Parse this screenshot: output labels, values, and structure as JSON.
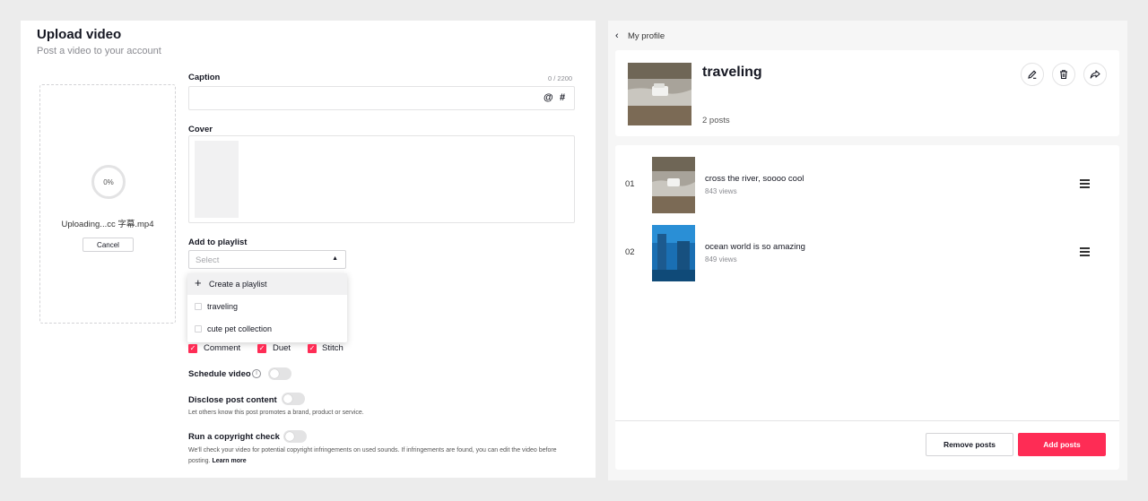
{
  "upload": {
    "title": "Upload video",
    "subtitle": "Post a video to your account",
    "progress": "0%",
    "filename": "Uploading...cc 字幕.mp4",
    "cancel_label": "Cancel"
  },
  "caption": {
    "label": "Caption",
    "counter": "0 / 2200",
    "value": "",
    "mention_icon": "@",
    "hashtag_icon": "#"
  },
  "cover": {
    "label": "Cover"
  },
  "playlist": {
    "label": "Add to playlist",
    "placeholder": "Select",
    "options": [
      {
        "label": "Create a playlist",
        "icon": "plus-icon"
      },
      {
        "label": "traveling",
        "checked": false
      },
      {
        "label": "cute pet collection",
        "checked": false
      }
    ]
  },
  "allow": {
    "items": [
      {
        "label": "Comment",
        "checked": true
      },
      {
        "label": "Duet",
        "checked": true
      },
      {
        "label": "Stitch",
        "checked": true
      }
    ]
  },
  "schedule": {
    "label": "Schedule video",
    "enabled": false
  },
  "disclose": {
    "label": "Disclose post content",
    "enabled": false,
    "note": "Let others know this post promotes a brand, product or service."
  },
  "copyright": {
    "label": "Run a copyright check",
    "enabled": false,
    "note": "We'll check your video for potential copyright infringements on used sounds. If infringements are found, you can edit the video before posting.",
    "learn_more": "Learn more"
  },
  "profile": {
    "back_label": "My profile",
    "playlist_name": "traveling",
    "post_count": "2 posts",
    "actions": [
      "edit-icon",
      "trash-icon",
      "share-icon"
    ],
    "posts": [
      {
        "index": "01",
        "title": "cross the river, soooo cool",
        "views": "843 views"
      },
      {
        "index": "02",
        "title": "ocean world is so amazing",
        "views": "849 views"
      }
    ],
    "remove_label": "Remove posts",
    "add_label": "Add posts"
  },
  "colors": {
    "accent": "#fe2c55",
    "panel_bg": "#ffffff",
    "page_bg": "#ececec"
  }
}
